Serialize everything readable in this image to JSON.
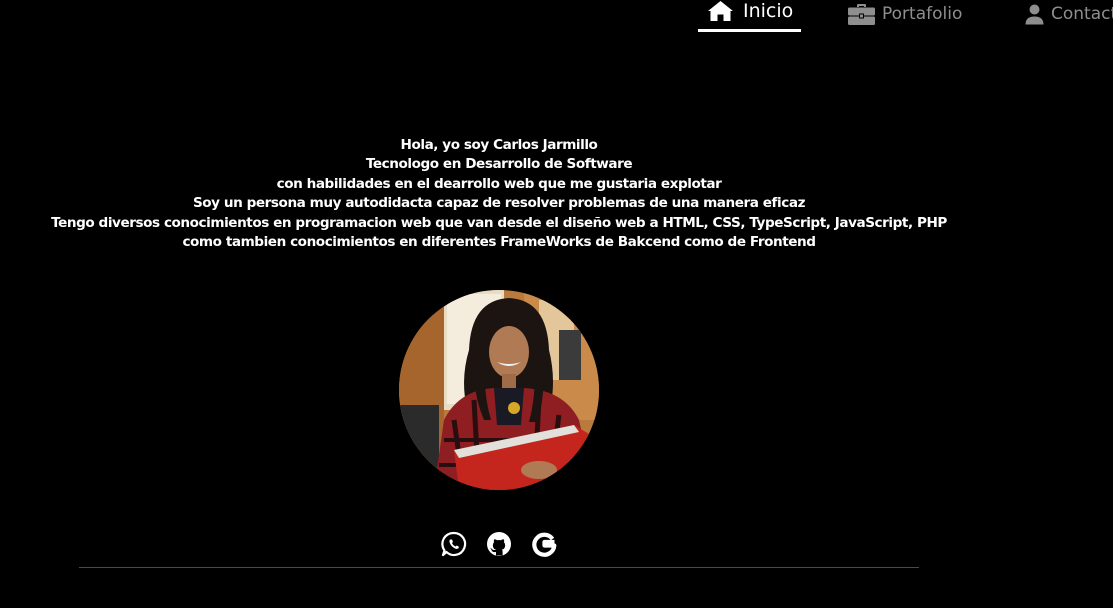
{
  "nav": {
    "items": [
      {
        "label": "Inicio",
        "icon": "home-icon",
        "active": true
      },
      {
        "label": "Portafolio",
        "icon": "briefcase-icon",
        "active": false
      },
      {
        "label": "Contact",
        "icon": "user-icon",
        "active": false
      }
    ]
  },
  "about": {
    "lines": [
      "Hola, yo soy Carlos Jarmillo",
      "Tecnologo en Desarrollo de Software",
      "con habilidades en el dearrollo web que me gustaria explotar",
      "Soy un persona muy autodidacta capaz de resolver problemas de una manera eficaz",
      "Tengo diversos conocimientos en programacion web que van desde el diseño web a HTML, CSS, TypeScript, JavaScript, PHP",
      "como tambien conocimientos en diferentes FrameWorks de Bakcend como de Frontend"
    ]
  },
  "social": {
    "icons": [
      "whatsapp-icon",
      "github-icon",
      "google-icon"
    ]
  },
  "colors": {
    "background": "#000000",
    "text": "#ffffff",
    "nav_inactive": "#8e8e8e",
    "divider": "#4a4a4a"
  }
}
